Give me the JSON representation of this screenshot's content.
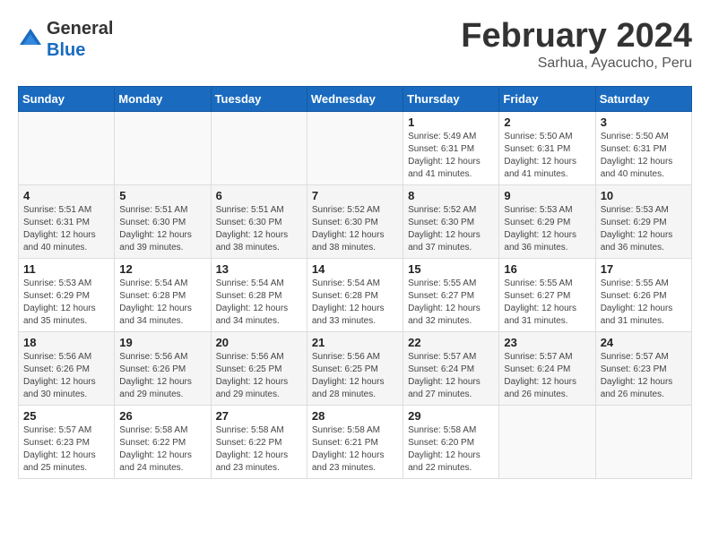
{
  "header": {
    "logo_general": "General",
    "logo_blue": "Blue",
    "month_title": "February 2024",
    "location": "Sarhua, Ayacucho, Peru"
  },
  "days_of_week": [
    "Sunday",
    "Monday",
    "Tuesday",
    "Wednesday",
    "Thursday",
    "Friday",
    "Saturday"
  ],
  "weeks": [
    [
      {
        "day": "",
        "info": ""
      },
      {
        "day": "",
        "info": ""
      },
      {
        "day": "",
        "info": ""
      },
      {
        "day": "",
        "info": ""
      },
      {
        "day": "1",
        "info": "Sunrise: 5:49 AM\nSunset: 6:31 PM\nDaylight: 12 hours and 41 minutes."
      },
      {
        "day": "2",
        "info": "Sunrise: 5:50 AM\nSunset: 6:31 PM\nDaylight: 12 hours and 41 minutes."
      },
      {
        "day": "3",
        "info": "Sunrise: 5:50 AM\nSunset: 6:31 PM\nDaylight: 12 hours and 40 minutes."
      }
    ],
    [
      {
        "day": "4",
        "info": "Sunrise: 5:51 AM\nSunset: 6:31 PM\nDaylight: 12 hours and 40 minutes."
      },
      {
        "day": "5",
        "info": "Sunrise: 5:51 AM\nSunset: 6:30 PM\nDaylight: 12 hours and 39 minutes."
      },
      {
        "day": "6",
        "info": "Sunrise: 5:51 AM\nSunset: 6:30 PM\nDaylight: 12 hours and 38 minutes."
      },
      {
        "day": "7",
        "info": "Sunrise: 5:52 AM\nSunset: 6:30 PM\nDaylight: 12 hours and 38 minutes."
      },
      {
        "day": "8",
        "info": "Sunrise: 5:52 AM\nSunset: 6:30 PM\nDaylight: 12 hours and 37 minutes."
      },
      {
        "day": "9",
        "info": "Sunrise: 5:53 AM\nSunset: 6:29 PM\nDaylight: 12 hours and 36 minutes."
      },
      {
        "day": "10",
        "info": "Sunrise: 5:53 AM\nSunset: 6:29 PM\nDaylight: 12 hours and 36 minutes."
      }
    ],
    [
      {
        "day": "11",
        "info": "Sunrise: 5:53 AM\nSunset: 6:29 PM\nDaylight: 12 hours and 35 minutes."
      },
      {
        "day": "12",
        "info": "Sunrise: 5:54 AM\nSunset: 6:28 PM\nDaylight: 12 hours and 34 minutes."
      },
      {
        "day": "13",
        "info": "Sunrise: 5:54 AM\nSunset: 6:28 PM\nDaylight: 12 hours and 34 minutes."
      },
      {
        "day": "14",
        "info": "Sunrise: 5:54 AM\nSunset: 6:28 PM\nDaylight: 12 hours and 33 minutes."
      },
      {
        "day": "15",
        "info": "Sunrise: 5:55 AM\nSunset: 6:27 PM\nDaylight: 12 hours and 32 minutes."
      },
      {
        "day": "16",
        "info": "Sunrise: 5:55 AM\nSunset: 6:27 PM\nDaylight: 12 hours and 31 minutes."
      },
      {
        "day": "17",
        "info": "Sunrise: 5:55 AM\nSunset: 6:26 PM\nDaylight: 12 hours and 31 minutes."
      }
    ],
    [
      {
        "day": "18",
        "info": "Sunrise: 5:56 AM\nSunset: 6:26 PM\nDaylight: 12 hours and 30 minutes."
      },
      {
        "day": "19",
        "info": "Sunrise: 5:56 AM\nSunset: 6:26 PM\nDaylight: 12 hours and 29 minutes."
      },
      {
        "day": "20",
        "info": "Sunrise: 5:56 AM\nSunset: 6:25 PM\nDaylight: 12 hours and 29 minutes."
      },
      {
        "day": "21",
        "info": "Sunrise: 5:56 AM\nSunset: 6:25 PM\nDaylight: 12 hours and 28 minutes."
      },
      {
        "day": "22",
        "info": "Sunrise: 5:57 AM\nSunset: 6:24 PM\nDaylight: 12 hours and 27 minutes."
      },
      {
        "day": "23",
        "info": "Sunrise: 5:57 AM\nSunset: 6:24 PM\nDaylight: 12 hours and 26 minutes."
      },
      {
        "day": "24",
        "info": "Sunrise: 5:57 AM\nSunset: 6:23 PM\nDaylight: 12 hours and 26 minutes."
      }
    ],
    [
      {
        "day": "25",
        "info": "Sunrise: 5:57 AM\nSunset: 6:23 PM\nDaylight: 12 hours and 25 minutes."
      },
      {
        "day": "26",
        "info": "Sunrise: 5:58 AM\nSunset: 6:22 PM\nDaylight: 12 hours and 24 minutes."
      },
      {
        "day": "27",
        "info": "Sunrise: 5:58 AM\nSunset: 6:22 PM\nDaylight: 12 hours and 23 minutes."
      },
      {
        "day": "28",
        "info": "Sunrise: 5:58 AM\nSunset: 6:21 PM\nDaylight: 12 hours and 23 minutes."
      },
      {
        "day": "29",
        "info": "Sunrise: 5:58 AM\nSunset: 6:20 PM\nDaylight: 12 hours and 22 minutes."
      },
      {
        "day": "",
        "info": ""
      },
      {
        "day": "",
        "info": ""
      }
    ]
  ]
}
